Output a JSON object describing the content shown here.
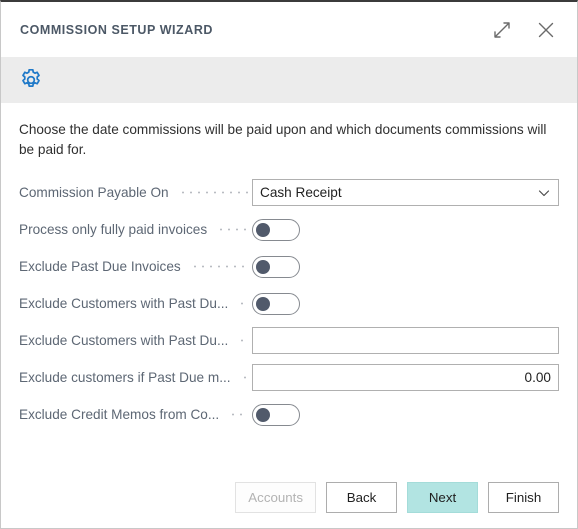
{
  "window": {
    "title": "COMMISSION SETUP WIZARD",
    "expand_icon": "expand-diagonal-icon",
    "close_icon": "close-icon",
    "banner_icon": "gear-icon",
    "accent_color": "#b2e4e2",
    "banner_bg": "#ececec",
    "gear_color": "#1f79c8"
  },
  "intro": {
    "text": "Choose the date commissions will be paid upon and which documents commissions will be paid for."
  },
  "fields": [
    {
      "label": "Commission Payable On",
      "type": "select",
      "value": "Cash Receipt",
      "chevron_icon": "chevron-down-icon",
      "name": "commission-payable-on"
    },
    {
      "label": "Process only fully paid invoices",
      "type": "toggle",
      "value": "off",
      "name": "process-only-fully-paid-invoices"
    },
    {
      "label": "Exclude Past Due Invoices",
      "type": "toggle",
      "value": "off",
      "name": "exclude-past-due-invoices"
    },
    {
      "label": "Exclude Customers with Past Du...",
      "type": "toggle",
      "value": "off",
      "name": "exclude-customers-with-past-due-toggle"
    },
    {
      "label": "Exclude Customers with Past Du...",
      "type": "input",
      "value": "",
      "placeholder": "",
      "align": "left",
      "name": "exclude-customers-with-past-due-field"
    },
    {
      "label": "Exclude customers if Past Due m...",
      "type": "input",
      "value": "0.00",
      "placeholder": "",
      "align": "right",
      "name": "exclude-customers-if-past-due-amount"
    },
    {
      "label": "Exclude Credit Memos from Co...",
      "type": "toggle",
      "value": "off",
      "name": "exclude-credit-memos-from-commission"
    }
  ],
  "footer": {
    "buttons": [
      {
        "label": "Accounts",
        "state": "disabled",
        "name": "accounts-button"
      },
      {
        "label": "Back",
        "state": "normal",
        "name": "back-button"
      },
      {
        "label": "Next",
        "state": "primary",
        "name": "next-button"
      },
      {
        "label": "Finish",
        "state": "normal",
        "name": "finish-button"
      }
    ]
  }
}
